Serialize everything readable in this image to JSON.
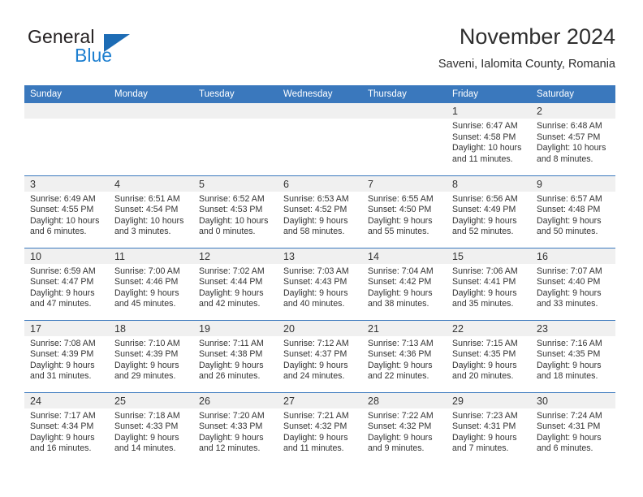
{
  "brand": {
    "name_part1": "General",
    "name_part2": "Blue",
    "triangle_color": "#1d6cb5",
    "blue_color": "#1d7fd0"
  },
  "header": {
    "title": "November 2024",
    "subtitle": "Saveni, Ialomita County, Romania"
  },
  "theme": {
    "header_bg": "#3a78bd",
    "daynum_bg": "#f0f0f0",
    "text": "#333333"
  },
  "weekday_headers": [
    "Sunday",
    "Monday",
    "Tuesday",
    "Wednesday",
    "Thursday",
    "Friday",
    "Saturday"
  ],
  "weeks": [
    [
      {
        "day": "",
        "sunrise": "",
        "sunset": "",
        "daylight_line1": "",
        "daylight_line2": ""
      },
      {
        "day": "",
        "sunrise": "",
        "sunset": "",
        "daylight_line1": "",
        "daylight_line2": ""
      },
      {
        "day": "",
        "sunrise": "",
        "sunset": "",
        "daylight_line1": "",
        "daylight_line2": ""
      },
      {
        "day": "",
        "sunrise": "",
        "sunset": "",
        "daylight_line1": "",
        "daylight_line2": ""
      },
      {
        "day": "",
        "sunrise": "",
        "sunset": "",
        "daylight_line1": "",
        "daylight_line2": ""
      },
      {
        "day": "1",
        "sunrise": "Sunrise: 6:47 AM",
        "sunset": "Sunset: 4:58 PM",
        "daylight_line1": "Daylight: 10 hours",
        "daylight_line2": "and 11 minutes."
      },
      {
        "day": "2",
        "sunrise": "Sunrise: 6:48 AM",
        "sunset": "Sunset: 4:57 PM",
        "daylight_line1": "Daylight: 10 hours",
        "daylight_line2": "and 8 minutes."
      }
    ],
    [
      {
        "day": "3",
        "sunrise": "Sunrise: 6:49 AM",
        "sunset": "Sunset: 4:55 PM",
        "daylight_line1": "Daylight: 10 hours",
        "daylight_line2": "and 6 minutes."
      },
      {
        "day": "4",
        "sunrise": "Sunrise: 6:51 AM",
        "sunset": "Sunset: 4:54 PM",
        "daylight_line1": "Daylight: 10 hours",
        "daylight_line2": "and 3 minutes."
      },
      {
        "day": "5",
        "sunrise": "Sunrise: 6:52 AM",
        "sunset": "Sunset: 4:53 PM",
        "daylight_line1": "Daylight: 10 hours",
        "daylight_line2": "and 0 minutes."
      },
      {
        "day": "6",
        "sunrise": "Sunrise: 6:53 AM",
        "sunset": "Sunset: 4:52 PM",
        "daylight_line1": "Daylight: 9 hours",
        "daylight_line2": "and 58 minutes."
      },
      {
        "day": "7",
        "sunrise": "Sunrise: 6:55 AM",
        "sunset": "Sunset: 4:50 PM",
        "daylight_line1": "Daylight: 9 hours",
        "daylight_line2": "and 55 minutes."
      },
      {
        "day": "8",
        "sunrise": "Sunrise: 6:56 AM",
        "sunset": "Sunset: 4:49 PM",
        "daylight_line1": "Daylight: 9 hours",
        "daylight_line2": "and 52 minutes."
      },
      {
        "day": "9",
        "sunrise": "Sunrise: 6:57 AM",
        "sunset": "Sunset: 4:48 PM",
        "daylight_line1": "Daylight: 9 hours",
        "daylight_line2": "and 50 minutes."
      }
    ],
    [
      {
        "day": "10",
        "sunrise": "Sunrise: 6:59 AM",
        "sunset": "Sunset: 4:47 PM",
        "daylight_line1": "Daylight: 9 hours",
        "daylight_line2": "and 47 minutes."
      },
      {
        "day": "11",
        "sunrise": "Sunrise: 7:00 AM",
        "sunset": "Sunset: 4:46 PM",
        "daylight_line1": "Daylight: 9 hours",
        "daylight_line2": "and 45 minutes."
      },
      {
        "day": "12",
        "sunrise": "Sunrise: 7:02 AM",
        "sunset": "Sunset: 4:44 PM",
        "daylight_line1": "Daylight: 9 hours",
        "daylight_line2": "and 42 minutes."
      },
      {
        "day": "13",
        "sunrise": "Sunrise: 7:03 AM",
        "sunset": "Sunset: 4:43 PM",
        "daylight_line1": "Daylight: 9 hours",
        "daylight_line2": "and 40 minutes."
      },
      {
        "day": "14",
        "sunrise": "Sunrise: 7:04 AM",
        "sunset": "Sunset: 4:42 PM",
        "daylight_line1": "Daylight: 9 hours",
        "daylight_line2": "and 38 minutes."
      },
      {
        "day": "15",
        "sunrise": "Sunrise: 7:06 AM",
        "sunset": "Sunset: 4:41 PM",
        "daylight_line1": "Daylight: 9 hours",
        "daylight_line2": "and 35 minutes."
      },
      {
        "day": "16",
        "sunrise": "Sunrise: 7:07 AM",
        "sunset": "Sunset: 4:40 PM",
        "daylight_line1": "Daylight: 9 hours",
        "daylight_line2": "and 33 minutes."
      }
    ],
    [
      {
        "day": "17",
        "sunrise": "Sunrise: 7:08 AM",
        "sunset": "Sunset: 4:39 PM",
        "daylight_line1": "Daylight: 9 hours",
        "daylight_line2": "and 31 minutes."
      },
      {
        "day": "18",
        "sunrise": "Sunrise: 7:10 AM",
        "sunset": "Sunset: 4:39 PM",
        "daylight_line1": "Daylight: 9 hours",
        "daylight_line2": "and 29 minutes."
      },
      {
        "day": "19",
        "sunrise": "Sunrise: 7:11 AM",
        "sunset": "Sunset: 4:38 PM",
        "daylight_line1": "Daylight: 9 hours",
        "daylight_line2": "and 26 minutes."
      },
      {
        "day": "20",
        "sunrise": "Sunrise: 7:12 AM",
        "sunset": "Sunset: 4:37 PM",
        "daylight_line1": "Daylight: 9 hours",
        "daylight_line2": "and 24 minutes."
      },
      {
        "day": "21",
        "sunrise": "Sunrise: 7:13 AM",
        "sunset": "Sunset: 4:36 PM",
        "daylight_line1": "Daylight: 9 hours",
        "daylight_line2": "and 22 minutes."
      },
      {
        "day": "22",
        "sunrise": "Sunrise: 7:15 AM",
        "sunset": "Sunset: 4:35 PM",
        "daylight_line1": "Daylight: 9 hours",
        "daylight_line2": "and 20 minutes."
      },
      {
        "day": "23",
        "sunrise": "Sunrise: 7:16 AM",
        "sunset": "Sunset: 4:35 PM",
        "daylight_line1": "Daylight: 9 hours",
        "daylight_line2": "and 18 minutes."
      }
    ],
    [
      {
        "day": "24",
        "sunrise": "Sunrise: 7:17 AM",
        "sunset": "Sunset: 4:34 PM",
        "daylight_line1": "Daylight: 9 hours",
        "daylight_line2": "and 16 minutes."
      },
      {
        "day": "25",
        "sunrise": "Sunrise: 7:18 AM",
        "sunset": "Sunset: 4:33 PM",
        "daylight_line1": "Daylight: 9 hours",
        "daylight_line2": "and 14 minutes."
      },
      {
        "day": "26",
        "sunrise": "Sunrise: 7:20 AM",
        "sunset": "Sunset: 4:33 PM",
        "daylight_line1": "Daylight: 9 hours",
        "daylight_line2": "and 12 minutes."
      },
      {
        "day": "27",
        "sunrise": "Sunrise: 7:21 AM",
        "sunset": "Sunset: 4:32 PM",
        "daylight_line1": "Daylight: 9 hours",
        "daylight_line2": "and 11 minutes."
      },
      {
        "day": "28",
        "sunrise": "Sunrise: 7:22 AM",
        "sunset": "Sunset: 4:32 PM",
        "daylight_line1": "Daylight: 9 hours",
        "daylight_line2": "and 9 minutes."
      },
      {
        "day": "29",
        "sunrise": "Sunrise: 7:23 AM",
        "sunset": "Sunset: 4:31 PM",
        "daylight_line1": "Daylight: 9 hours",
        "daylight_line2": "and 7 minutes."
      },
      {
        "day": "30",
        "sunrise": "Sunrise: 7:24 AM",
        "sunset": "Sunset: 4:31 PM",
        "daylight_line1": "Daylight: 9 hours",
        "daylight_line2": "and 6 minutes."
      }
    ]
  ]
}
